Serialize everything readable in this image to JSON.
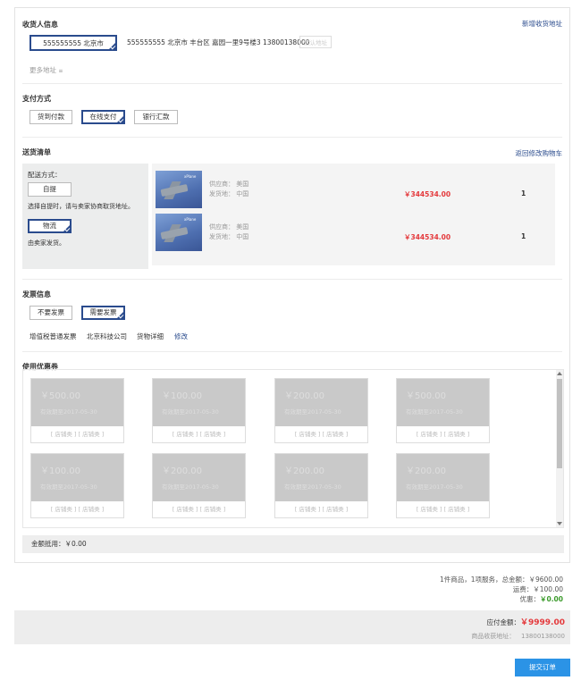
{
  "receiver": {
    "title": "收货人信息",
    "new_address": "新增收货地址",
    "selected": "555555555 北京市",
    "detail": "555555555 北京市 丰台区 嘉园一里9号楼3 13800138000",
    "default_tag": "默认地址",
    "more": "更多地址",
    "more_icon": "chevron-down-icon"
  },
  "payment": {
    "title": "支付方式",
    "options": [
      "货到付款",
      "在线支付",
      "银行汇款"
    ],
    "selected_index": 1
  },
  "shipping": {
    "title": "送货清单",
    "back_link": "返回修改购物车",
    "method_label": "配送方式：",
    "pickup_button": "自提",
    "pickup_note": "选择自提时，请与卖家协商取货地址。",
    "logistics_button": "物流",
    "logistics_note": "由卖家发货。",
    "items": [
      {
        "supplier": "供应商： 美国",
        "origin": "发货地： 中国",
        "price": "￥344534.00",
        "qty": "1"
      },
      {
        "supplier": "供应商： 美国",
        "origin": "发货地： 中国",
        "price": "￥344534.00",
        "qty": "1"
      }
    ]
  },
  "invoice": {
    "title": "发票信息",
    "options": [
      "不要发票",
      "需要发票"
    ],
    "selected_index": 1,
    "type": "增值税普通发票",
    "company": "北京科技公司",
    "content": "货物详细",
    "edit": "修改"
  },
  "coupons": {
    "title": "使用优惠券",
    "items": [
      {
        "amount": "￥500.00",
        "expiry": "有效期至2017-05-30",
        "scope": "[ 店铺类 ] [ 店铺类 ]"
      },
      {
        "amount": "￥100.00",
        "expiry": "有效期至2017-05-30",
        "scope": "[ 店铺类 ] [ 店铺类 ]"
      },
      {
        "amount": "￥200.00",
        "expiry": "有效期至2017-05-30",
        "scope": "[ 店铺类 ] [ 店铺类 ]"
      },
      {
        "amount": "￥500.00",
        "expiry": "有效期至2017-05-30",
        "scope": "[ 店铺类 ] [ 店铺类 ]"
      },
      {
        "amount": "￥100.00",
        "expiry": "有效期至2017-05-30",
        "scope": "[ 店铺类 ] [ 店铺类 ]"
      },
      {
        "amount": "￥200.00",
        "expiry": "有效期至2017-05-30",
        "scope": "[ 店铺类 ] [ 店铺类 ]"
      },
      {
        "amount": "￥200.00",
        "expiry": "有效期至2017-05-30",
        "scope": "[ 店铺类 ] [ 店铺类 ]"
      },
      {
        "amount": "￥200.00",
        "expiry": "有效期至2017-05-30",
        "scope": "[ 店铺类 ] [ 店铺类 ]"
      }
    ],
    "deduction": "金额抵用：￥0.00"
  },
  "summary": {
    "line1": "1件商品，1项服务，总金额：￥9600.00",
    "freight_label": "运费：",
    "freight": "￥100.00",
    "discount_label": "优惠：",
    "discount": "￥0.00",
    "payable_label": "应付金额：",
    "payable": "￥9999.00",
    "address_label": "商品收获地址：",
    "address": "13800138000"
  },
  "submit_label": "提交订单",
  "colors": {
    "accent": "#2a4b8d",
    "price": "#e4393c",
    "submit": "#2b93e6",
    "discount": "#3a9a2a"
  }
}
